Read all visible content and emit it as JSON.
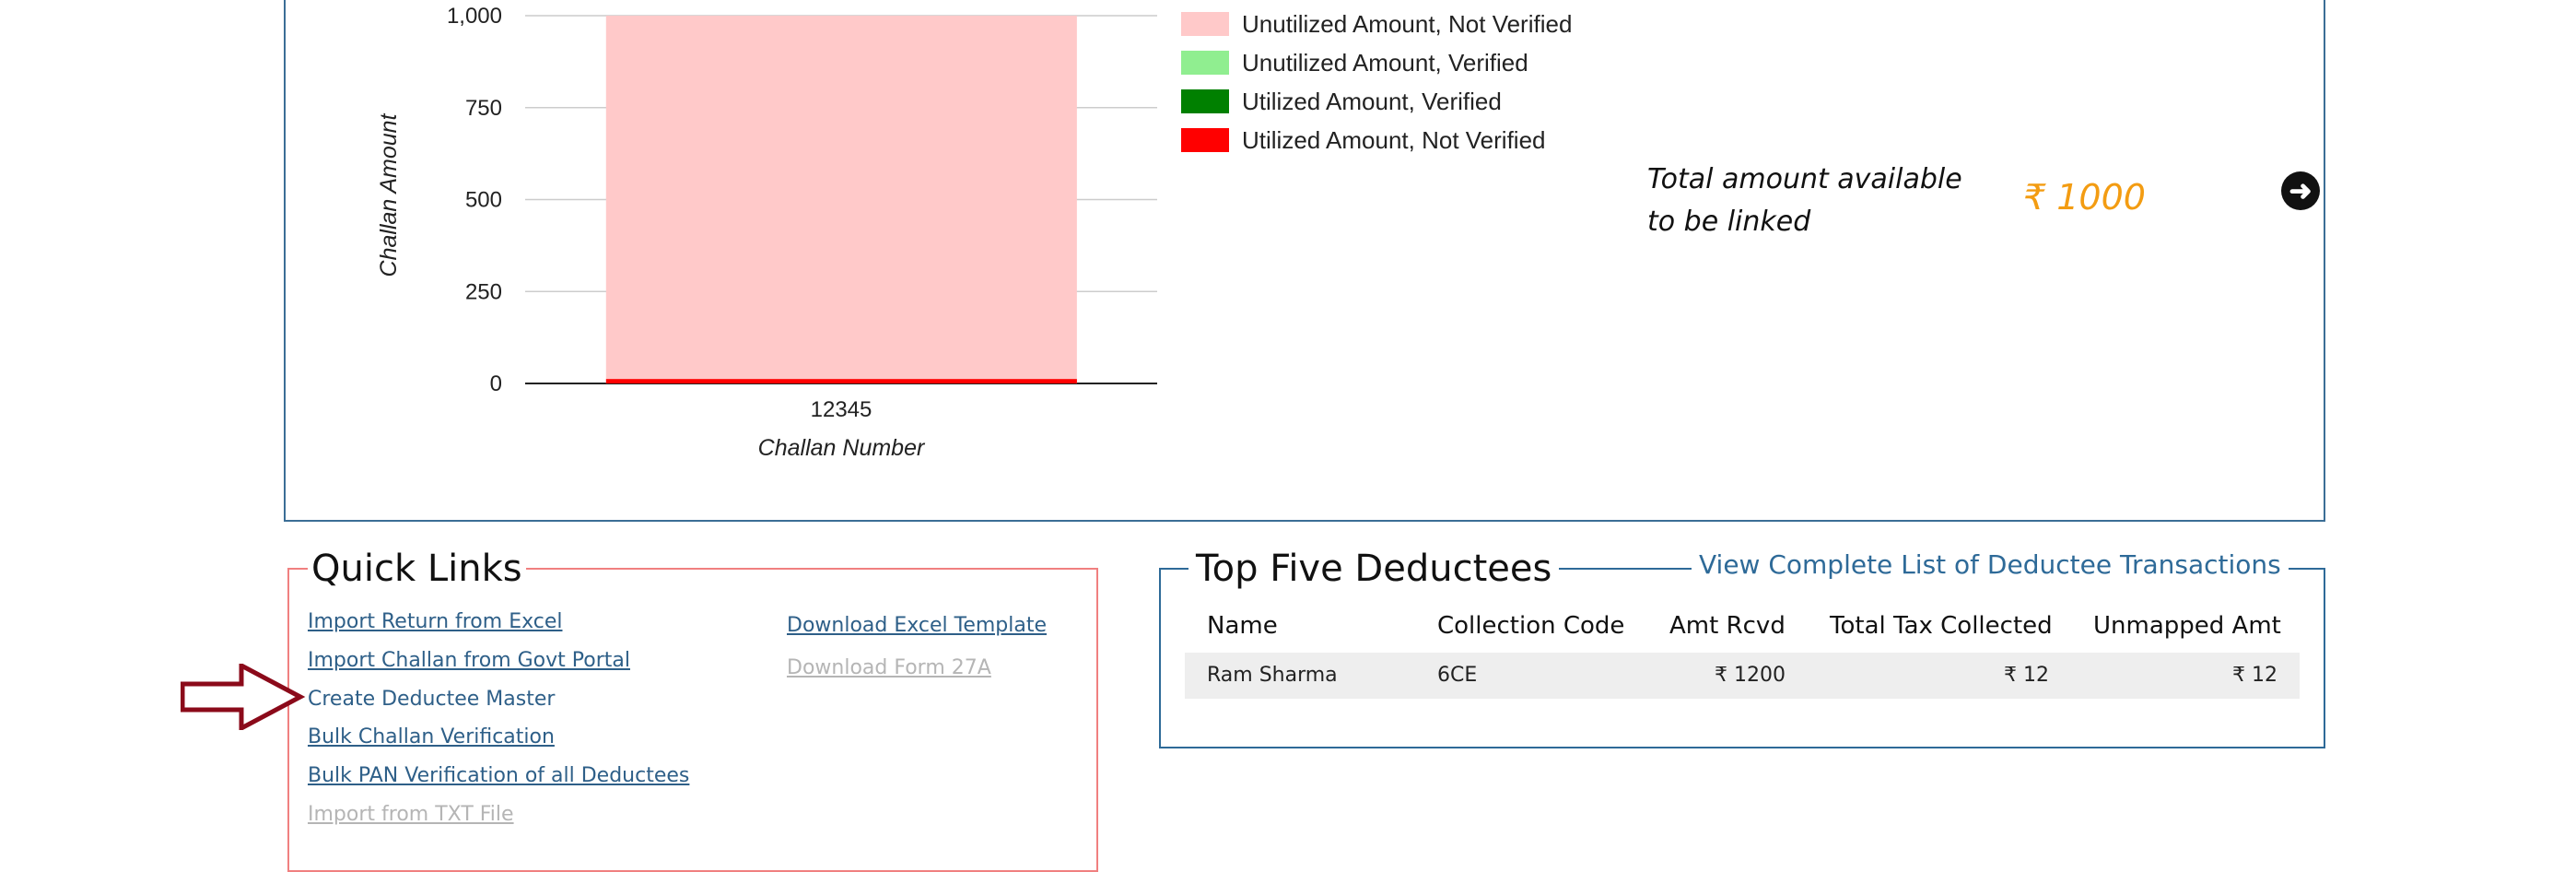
{
  "chart_data": {
    "type": "bar",
    "categories": [
      "12345"
    ],
    "series": [
      {
        "name": "Unutilized Amount, Not Verified",
        "color": "#ffc9c9",
        "values": [
          1000
        ]
      },
      {
        "name": "Unutilized Amount, Verified",
        "color": "#90ee90",
        "values": [
          0
        ]
      },
      {
        "name": "Utilized Amount, Verified",
        "color": "#008000",
        "values": [
          0
        ]
      },
      {
        "name": "Utilized Amount, Not Verified",
        "color": "#ff0000",
        "values": [
          12
        ]
      }
    ],
    "stacked": true,
    "xlabel": "Challan Number",
    "ylabel": "Challan Amount",
    "ylim": [
      0,
      1000
    ],
    "yticks": [
      "0",
      "250",
      "500",
      "750",
      "1,000"
    ],
    "ytick_values": [
      0,
      250,
      500,
      750,
      1000
    ],
    "grid": true,
    "legend_position": "right"
  },
  "summary": {
    "total_label_line1": "Total amount available",
    "total_label_line2": "to be linked",
    "total_value": "₹ 1000",
    "next_icon": "arrow-right-circle-icon"
  },
  "quick_links": {
    "title": "Quick Links",
    "left_column": [
      {
        "label": "Import Return from Excel",
        "enabled": true
      },
      {
        "label": "Import Challan from Govt Portal",
        "enabled": true
      },
      {
        "label": "Create Deductee Master",
        "enabled": true
      },
      {
        "label": "Bulk Challan Verification",
        "enabled": true
      },
      {
        "label": "Bulk PAN Verification of all Deductees",
        "enabled": true
      },
      {
        "label": "Import from TXT File",
        "enabled": false
      }
    ],
    "right_column": [
      {
        "label": "Download Excel Template",
        "enabled": true
      },
      {
        "label": "Download Form 27A",
        "enabled": false
      }
    ]
  },
  "deductees": {
    "title": "Top Five Deductees",
    "view_all_label": "View Complete List of Deductee Transactions",
    "columns": [
      "Name",
      "Collection Code",
      "Amt Rcvd",
      "Total Tax Collected",
      "Unmapped Amt"
    ],
    "rows": [
      [
        "Ram Sharma",
        "6CE",
        "₹ 1200",
        "₹ 12",
        "₹ 12"
      ]
    ]
  },
  "colors": {
    "panel_border": "#3b6e96",
    "quick_links_border": "#f08080",
    "link": "#2e5f88",
    "amount": "#f39c12",
    "pointer_arrow": "#8b0a1a"
  }
}
